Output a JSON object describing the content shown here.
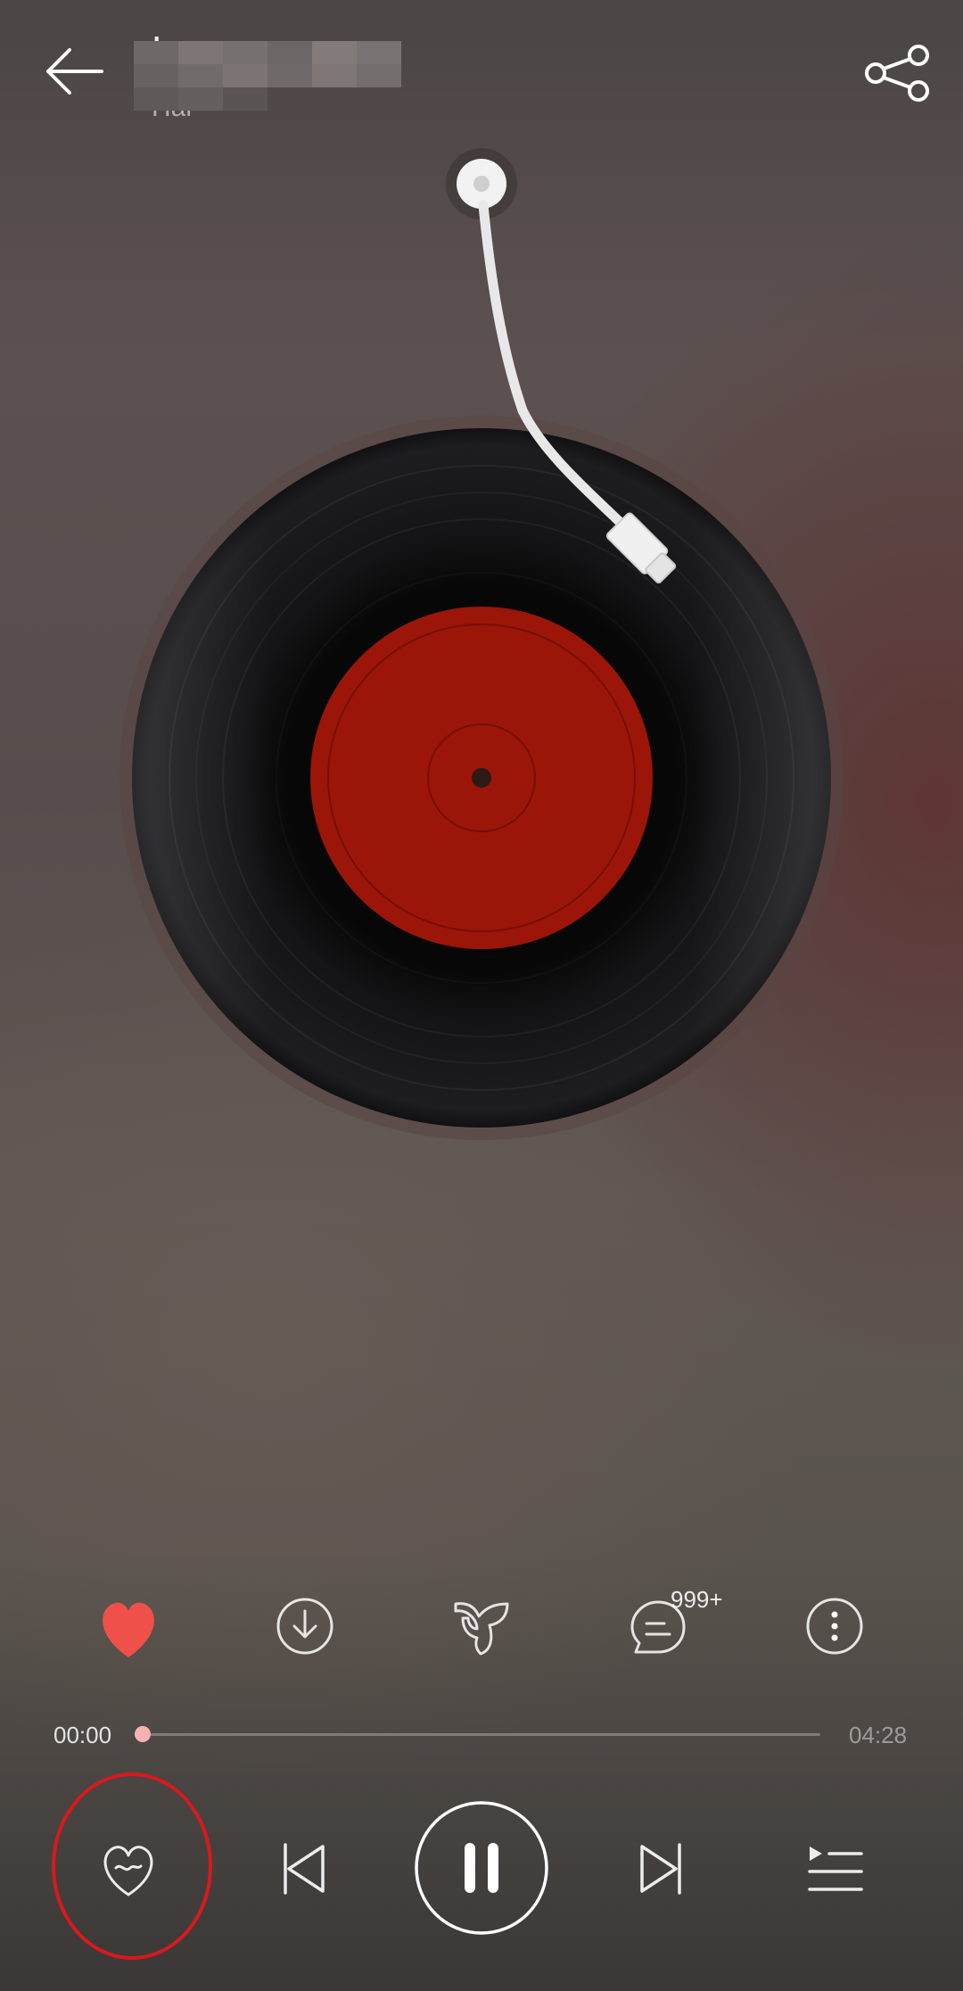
{
  "header": {
    "back_icon": "arrow-left-icon",
    "title": "L",
    "artist": "Hai",
    "share_icon": "share-icon"
  },
  "player": {
    "disc_label_color": "#9b1508",
    "accent_color": "#f0504a"
  },
  "actions": {
    "like_icon": "heart-filled-icon",
    "download_icon": "download-icon",
    "sound_effect_icon": "sound-effect-icon",
    "comment_icon": "comment-icon",
    "comment_count": "999+",
    "more_icon": "more-vertical-icon"
  },
  "progress": {
    "current": "00:00",
    "total": "04:28",
    "fraction": 0.0
  },
  "controls": {
    "mode_icon": "heart-mode-icon",
    "prev_icon": "skip-previous-icon",
    "pause_icon": "pause-icon",
    "next_icon": "skip-next-icon",
    "playlist_icon": "playlist-icon",
    "highlight_color": "#d8191e"
  }
}
